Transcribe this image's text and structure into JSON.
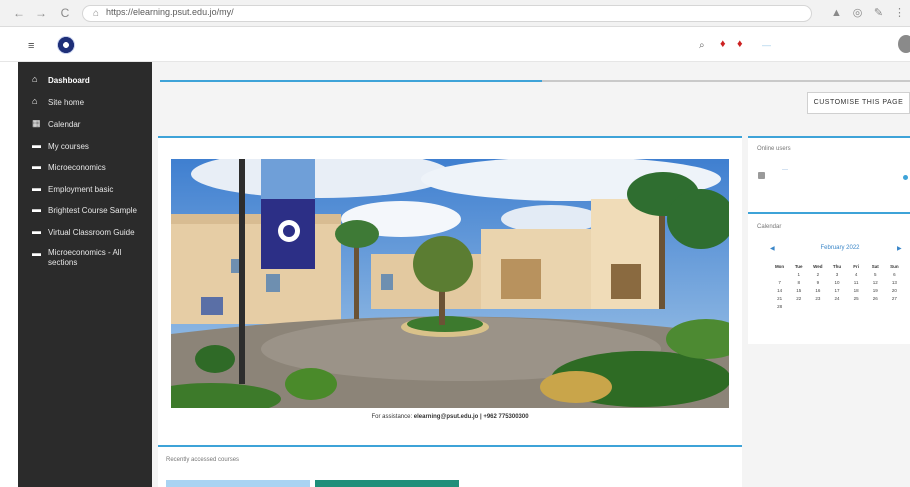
{
  "browser": {
    "url": "https://elearning.psut.edu.jo/my/",
    "nav_back": "←",
    "nav_forward": "→",
    "reload": "C",
    "home": "⌂"
  },
  "header": {
    "user_name": "—",
    "search_icon": "search-icon",
    "notification_icon": "bell-icon",
    "message_icon": "chat-icon"
  },
  "sidebar": {
    "items": [
      {
        "label": "Dashboard",
        "icon": "tachometer-icon",
        "glyph": "⌂",
        "active": true
      },
      {
        "label": "Site home",
        "icon": "home-icon",
        "glyph": "⌂",
        "active": false
      },
      {
        "label": "Calendar",
        "icon": "calendar-icon",
        "glyph": "▦",
        "active": false
      },
      {
        "label": "My courses",
        "icon": "graduation-cap-icon",
        "glyph": "▬",
        "active": false
      },
      {
        "label": "Microeconomics",
        "icon": "graduation-cap-icon",
        "glyph": "▬",
        "active": false
      },
      {
        "label": "Employment basic",
        "icon": "graduation-cap-icon",
        "glyph": "▬",
        "active": false
      },
      {
        "label": "Brightest Course Sample",
        "icon": "graduation-cap-icon",
        "glyph": "▬",
        "active": false
      },
      {
        "label": "Virtual Classroom Guide",
        "icon": "graduation-cap-icon",
        "glyph": "▬",
        "active": false
      },
      {
        "label": "Microeconomics - All sections",
        "icon": "graduation-cap-icon",
        "glyph": "▬",
        "active": false
      }
    ]
  },
  "page": {
    "customise_label": "CUSTOMISE THIS PAGE"
  },
  "main": {
    "contact_prefix": "For assistance: ",
    "contact_email": "elearning@psut.edu.jo",
    "contact_suffix": " | +962 775300300",
    "recent_title": "Recently accessed courses"
  },
  "online_users": {
    "title": "Online users",
    "user": "—"
  },
  "calendar": {
    "title": "Calendar",
    "month": "February 2022",
    "weekdays": [
      "Mon",
      "Tue",
      "Wed",
      "Thu",
      "Fri",
      "Sat",
      "Sun"
    ],
    "weeks": [
      [
        "",
        "1",
        "2",
        "3",
        "4",
        "5",
        "6"
      ],
      [
        "7",
        "8",
        "9",
        "10",
        "11",
        "12",
        "13"
      ],
      [
        "14",
        "15",
        "16",
        "17",
        "18",
        "19",
        "20"
      ],
      [
        "21",
        "22",
        "23",
        "24",
        "25",
        "26",
        "27"
      ],
      [
        "28",
        "",
        "",
        "",
        "",
        "",
        ""
      ]
    ]
  },
  "colors": {
    "accent": "#3ea3d8",
    "sidebar_bg": "#2b2b2b",
    "page_bg": "#f4f4f4"
  }
}
